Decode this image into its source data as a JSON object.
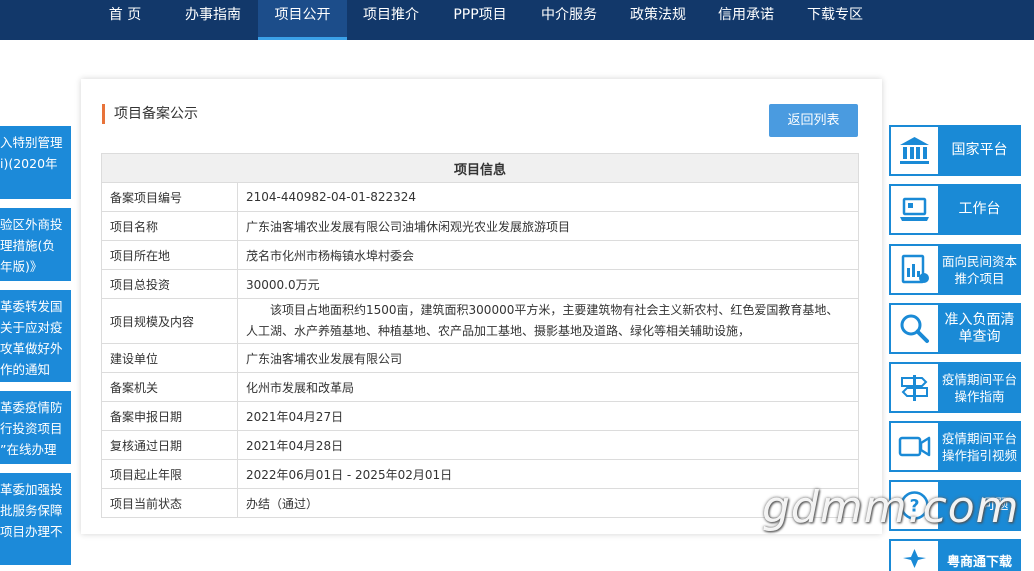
{
  "nav": {
    "items": [
      {
        "label": "首 页"
      },
      {
        "label": "办事指南"
      },
      {
        "label": "项目公开"
      },
      {
        "label": "项目推介"
      },
      {
        "label": "PPP项目"
      },
      {
        "label": "中介服务"
      },
      {
        "label": "政策法规"
      },
      {
        "label": "信用承诺"
      },
      {
        "label": "下载专区"
      }
    ],
    "active_index": 2,
    "colors": {
      "bar": "#12386a",
      "active": "#1c4d8a",
      "underline": "#3ba1e8"
    }
  },
  "left_cards": [
    {
      "lines": [
        "入特别管理",
        "i)(2020年",
        ""
      ]
    },
    {
      "lines": [
        "验区外商投",
        "理措施(负",
        "年版)》"
      ]
    },
    {
      "lines": [
        "革委转发国",
        "关于应对疫",
        "攻革做好外",
        "作的通知"
      ]
    },
    {
      "lines": [
        "革委疫情防",
        "行投资项目",
        "”在线办理"
      ]
    },
    {
      "lines": [
        "革委加强投",
        "批服务保障",
        "项目办理不"
      ]
    }
  ],
  "panel": {
    "title": "项目备案公示",
    "back_button": "返回列表",
    "table_header": "项目信息",
    "rows": [
      {
        "label": "备案项目编号",
        "value": "2104-440982-04-01-822324"
      },
      {
        "label": "项目名称",
        "value": "广东油客埔农业发展有限公司油埔休闲观光农业发展旅游项目"
      },
      {
        "label": "项目所在地",
        "value": "茂名市化州市杨梅镇水埠村委会"
      },
      {
        "label": "项目总投资",
        "value": "30000.0万元"
      },
      {
        "label": "项目规模及内容",
        "value": "该项目占地面积约1500亩，建筑面积300000平方米，主要建筑物有社会主义新农村、红色爱国教育基地、人工湖、水产养殖基地、种植基地、农产品加工基地、摄影基地及道路、绿化等相关辅助设施，"
      },
      {
        "label": "建设单位",
        "value": "广东油客埔农业发展有限公司"
      },
      {
        "label": "备案机关",
        "value": "化州市发展和改革局"
      },
      {
        "label": "备案申报日期",
        "value": "2021年04月27日"
      },
      {
        "label": "复核通过日期",
        "value": "2021年04月28日"
      },
      {
        "label": "项目起止年限",
        "value": "2022年06月01日 - 2025年02月01日"
      },
      {
        "label": "项目当前状态",
        "value": "办结（通过）"
      }
    ]
  },
  "right_buttons": [
    {
      "label": "国家平台",
      "icon": "bank-icon"
    },
    {
      "label": "工作台",
      "icon": "laptop-icon"
    },
    {
      "label": "面向民间资本推介项目",
      "icon": "document-chart-icon"
    },
    {
      "label": "准入负面清单查询",
      "icon": "search-icon"
    },
    {
      "label": "疫情期间平台操作指南",
      "icon": "signpost-icon"
    },
    {
      "label": "疫情期间平台操作指引视频",
      "icon": "video-camera-icon"
    },
    {
      "label": "问题",
      "icon": "question-icon"
    },
    {
      "label": "粤商通下载",
      "icon": "app-icon"
    }
  ],
  "watermark": "gdmm.com"
}
